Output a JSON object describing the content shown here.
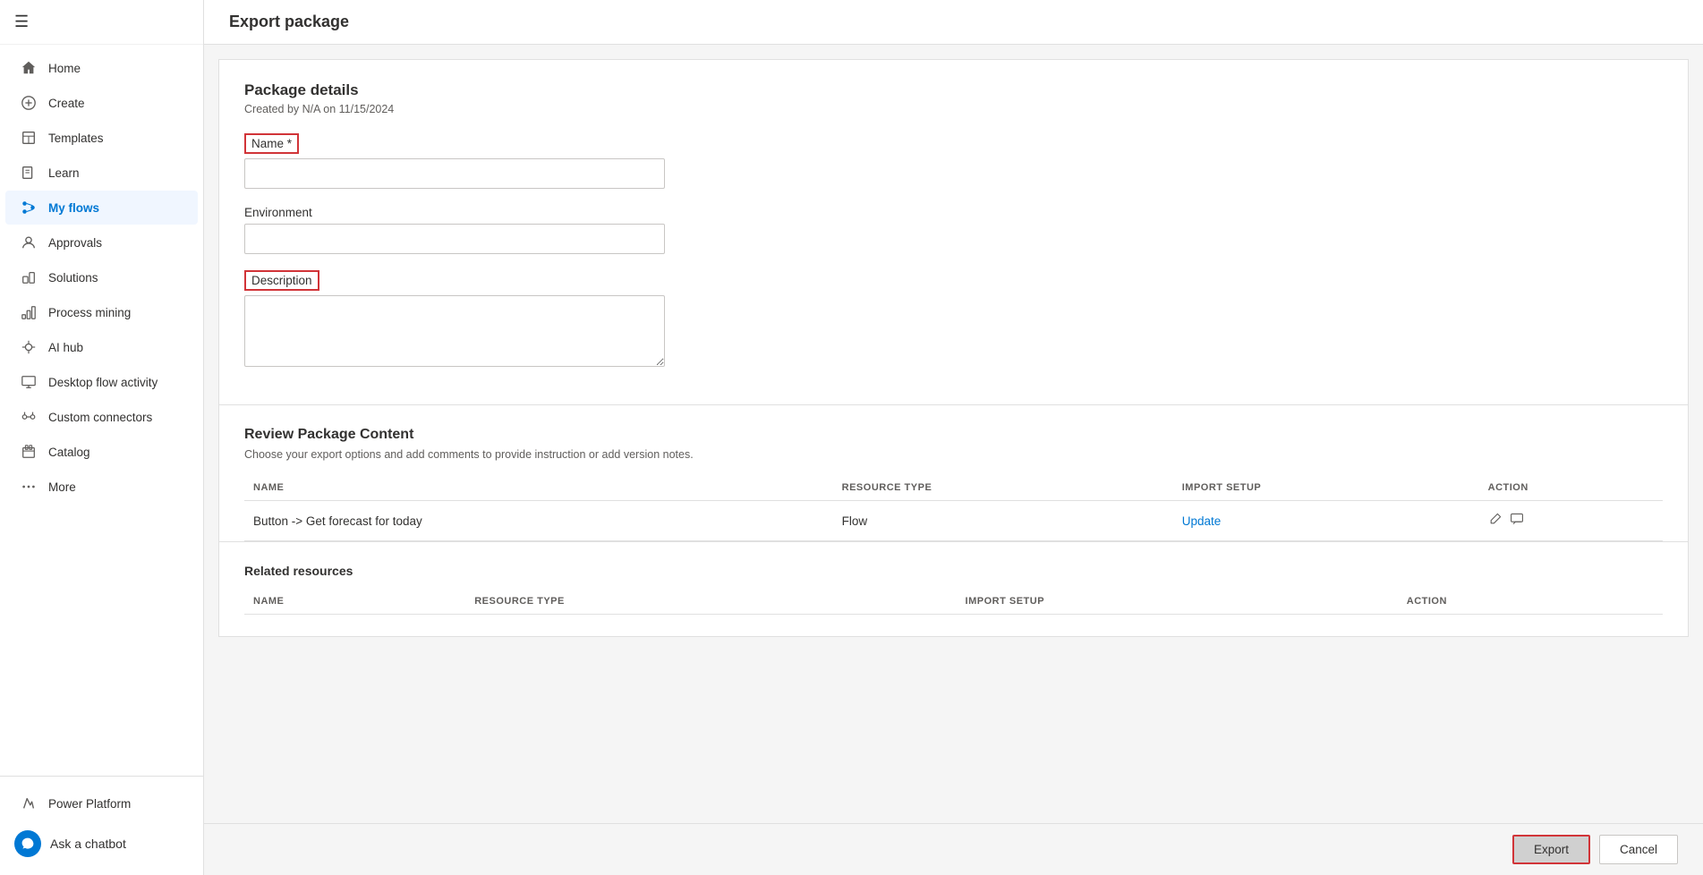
{
  "sidebar": {
    "hamburger_label": "☰",
    "items": [
      {
        "id": "home",
        "label": "Home",
        "icon": "⌂"
      },
      {
        "id": "create",
        "label": "Create",
        "icon": "+"
      },
      {
        "id": "templates",
        "label": "Templates",
        "icon": "📄"
      },
      {
        "id": "learn",
        "label": "Learn",
        "icon": "📖"
      },
      {
        "id": "my-flows",
        "label": "My flows",
        "icon": "💧",
        "active": true
      },
      {
        "id": "approvals",
        "label": "Approvals",
        "icon": "✔"
      },
      {
        "id": "solutions",
        "label": "Solutions",
        "icon": "🧩"
      },
      {
        "id": "process-mining",
        "label": "Process mining",
        "icon": "⛏"
      },
      {
        "id": "ai-hub",
        "label": "AI hub",
        "icon": "🤖"
      },
      {
        "id": "desktop-flow-activity",
        "label": "Desktop flow activity",
        "icon": "🖥"
      },
      {
        "id": "custom-connectors",
        "label": "Custom connectors",
        "icon": "🔌"
      },
      {
        "id": "catalog",
        "label": "Catalog",
        "icon": "📦"
      },
      {
        "id": "more",
        "label": "More",
        "icon": "···"
      }
    ],
    "power_platform_label": "Power Platform",
    "chatbot_label": "Ask a chatbot"
  },
  "page": {
    "title": "Export package"
  },
  "package_details": {
    "section_title": "Package details",
    "created_info": "Created by N/A on 11/15/2024",
    "name_label": "Name *",
    "name_placeholder": "",
    "environment_label": "Environment",
    "environment_placeholder": "",
    "description_label": "Description",
    "description_placeholder": ""
  },
  "review_package": {
    "section_title": "Review Package Content",
    "section_subtitle": "Choose your export options and add comments to provide instruction or add version notes.",
    "table_headers": {
      "name": "NAME",
      "resource_type": "RESOURCE TYPE",
      "import_setup": "IMPORT SETUP",
      "action": "ACTION"
    },
    "rows": [
      {
        "name": "Button -> Get forecast for today",
        "resource_type": "Flow",
        "import_setup": "Update",
        "action_edit": "✏",
        "action_comment": "💬"
      }
    ]
  },
  "related_resources": {
    "section_title": "Related resources",
    "table_headers": {
      "name": "NAME",
      "resource_type": "RESOURCE TYPE",
      "import_setup": "IMPORT SETUP",
      "action": "ACTION"
    }
  },
  "footer": {
    "export_label": "Export",
    "cancel_label": "Cancel"
  }
}
